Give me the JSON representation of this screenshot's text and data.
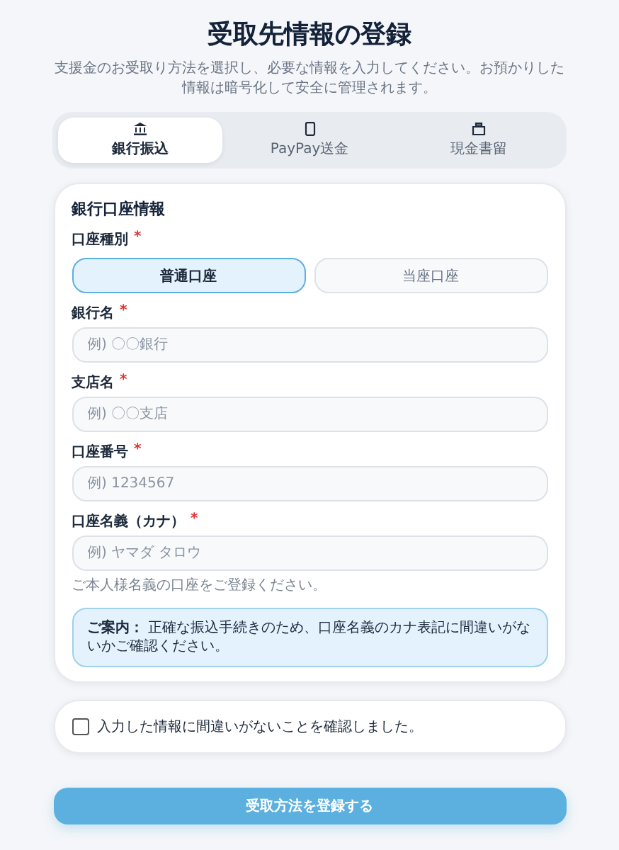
{
  "title": "受取先情報の登録",
  "subtitle": "支援金のお受取り方法を選択し、必要な情報を入力してください。お預かりした情報は暗号化して安全に管理されます。",
  "tabs": [
    {
      "label": "銀行振込",
      "kind": "bank",
      "selected": true
    },
    {
      "label": "PayPay送金",
      "kind": "mobile",
      "selected": false
    },
    {
      "label": "現金書留",
      "kind": "mail",
      "selected": false
    }
  ],
  "bank_section": {
    "heading": "銀行口座情報",
    "account_type": {
      "label": "口座種別",
      "required_mark": "*",
      "options": [
        {
          "label": "普通口座",
          "selected": true
        },
        {
          "label": "当座口座",
          "selected": false
        }
      ]
    },
    "fields": [
      {
        "label": "銀行名",
        "required_mark": "*",
        "placeholder": "例) 〇〇銀行"
      },
      {
        "label": "支店名",
        "required_mark": "*",
        "placeholder": "例) 〇〇支店"
      },
      {
        "label": "口座番号",
        "required_mark": "*",
        "placeholder": "例) 1234567"
      },
      {
        "label": "口座名義（カナ）",
        "required_mark": "*",
        "placeholder": "例) ヤマダ タロウ",
        "hint": "ご本人様名義の口座をご登録ください。"
      }
    ],
    "notice": "**ご案内：** 正確な振込手続きのため、口座名義のカナ表記に間違いがないかご確認ください。"
  },
  "confirmation": {
    "label": "入力した情報に間違いがないことを確認しました。",
    "checked": false
  },
  "submit_button": {
    "label": "受取方法を登録する"
  }
}
